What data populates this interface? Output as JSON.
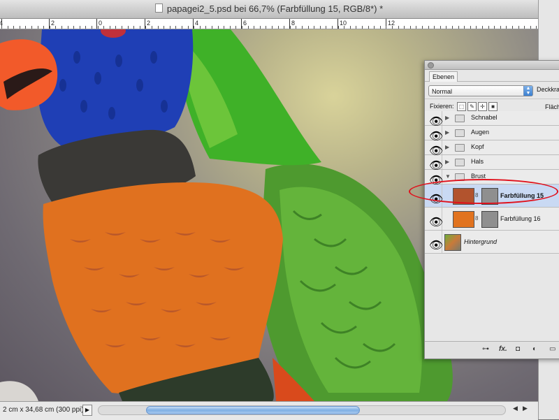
{
  "window": {
    "title": "papagei2_5.psd bei 66,7% (Farbfüllung 15, RGB/8*) *"
  },
  "ruler": {
    "numbers": [
      "4",
      "2",
      "0",
      "2",
      "4",
      "6",
      "8",
      "10",
      "12"
    ]
  },
  "status": {
    "doc_info": "2 cm x 34,68 cm (300 ppi)",
    "menu_arrow": "▶"
  },
  "layers_panel": {
    "tab": "Ebenen",
    "blend_mode": "Normal",
    "opacity_label": "Deckkraft",
    "lock_label": "Fixieren:",
    "fill_label": "Fläch",
    "layers": [
      {
        "name": "Schnabel",
        "type": "group",
        "expanded": false
      },
      {
        "name": "Augen",
        "type": "group",
        "expanded": false
      },
      {
        "name": "Kopf",
        "type": "group",
        "expanded": false
      },
      {
        "name": "Hals",
        "type": "group",
        "expanded": false
      },
      {
        "name": "Brust",
        "type": "group",
        "expanded": true
      },
      {
        "name": "Farbfüllung 15",
        "type": "fill",
        "color": "#b2532d",
        "selected": true
      },
      {
        "name": "Farbfüllung 16",
        "type": "fill",
        "color": "#e1731f",
        "selected": false
      },
      {
        "name": "Hintergrund",
        "type": "background"
      }
    ],
    "bottom_icons": [
      "link-icon",
      "fx-icon",
      "mask-icon",
      "adjustment-icon",
      "folder-icon"
    ],
    "fx_label": "fx."
  },
  "colors": {
    "selection_highlight": "#e0111c",
    "selected_row": "#c9d9f3"
  }
}
